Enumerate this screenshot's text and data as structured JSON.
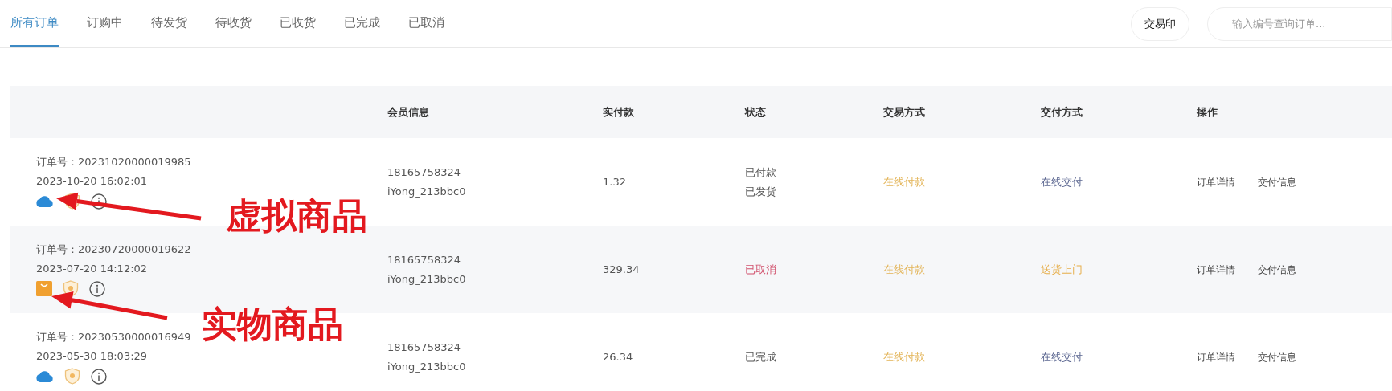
{
  "tabs": [
    {
      "label": "所有订单",
      "selected": true
    },
    {
      "label": "订购中",
      "selected": false
    },
    {
      "label": "待发货",
      "selected": false
    },
    {
      "label": "待收货",
      "selected": false
    },
    {
      "label": "已收货",
      "selected": false
    },
    {
      "label": "已完成",
      "selected": false
    },
    {
      "label": "已取消",
      "selected": false
    }
  ],
  "print_button": "交易印",
  "search": {
    "placeholder": "输入编号查询订单..."
  },
  "table": {
    "columns": [
      "会员信息",
      "实付款",
      "状态",
      "交易方式",
      "交付方式",
      "操作"
    ],
    "rows": [
      {
        "order_no": "订单号：20231020000019985",
        "time": "2023-10-20 16:02:01",
        "goods_icon": {
          "kind": "cloud"
        },
        "member": [
          "18165758324",
          "iYong_213bbc0"
        ],
        "paid": "1.32",
        "status": {
          "lines": [
            "已付款",
            "已发货"
          ],
          "color": "#555555"
        },
        "trade": {
          "text": "在线付款",
          "color": "#e3b457"
        },
        "delivery": {
          "text": "在线交付",
          "color": "#5c6791"
        },
        "actions": [
          "订单详情",
          "交付信息"
        ]
      },
      {
        "order_no": "订单号：20230720000019622",
        "time": "2023-07-20 14:12:02",
        "goods_icon": {
          "kind": "bag"
        },
        "member": [
          "18165758324",
          "iYong_213bbc0"
        ],
        "paid": "329.34",
        "status": {
          "lines": [
            "已取消"
          ],
          "color": "#d2546f"
        },
        "trade": {
          "text": "在线付款",
          "color": "#e3b457"
        },
        "delivery": {
          "text": "送货上门",
          "color": "#e7b04e"
        },
        "actions": [
          "订单详情",
          "交付信息"
        ]
      },
      {
        "order_no": "订单号：20230530000016949",
        "time": "2023-05-30 18:03:29",
        "goods_icon": {
          "kind": "cloud"
        },
        "member": [
          "18165758324",
          "iYong_213bbc0"
        ],
        "paid": "26.34",
        "status": {
          "lines": [
            "已完成"
          ],
          "color": "#555555"
        },
        "trade": {
          "text": "在线付款",
          "color": "#e3b457"
        },
        "delivery": {
          "text": "在线交付",
          "color": "#5c6791"
        },
        "actions": [
          "订单详情",
          "交付信息"
        ]
      }
    ]
  },
  "annotations": [
    "虚拟商品",
    "实物商品"
  ]
}
